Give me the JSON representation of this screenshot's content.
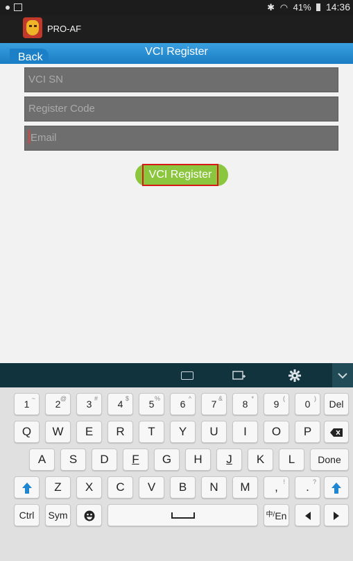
{
  "status_bar": {
    "battery": "41%",
    "time": "14:36",
    "bluetooth_icon": "bluetooth-icon",
    "wifi_icon": "wifi-icon"
  },
  "app": {
    "name": "PRO-AF",
    "logo_icon": "lion-logo-icon"
  },
  "nav": {
    "back_label": "Back",
    "title": "VCI Register"
  },
  "form": {
    "vci_sn_placeholder": "VCI SN",
    "register_code_placeholder": "Register Code",
    "email_placeholder": "Email",
    "register_button": "VCI Register"
  },
  "keyboard": {
    "toolbar_icons": [
      "keyboard-icon",
      "clipboard-icon",
      "gear-icon",
      "chevron-down-icon"
    ],
    "number_row": [
      {
        "main": "1",
        "sub": "~"
      },
      {
        "main": "2",
        "sub": "@"
      },
      {
        "main": "3",
        "sub": "#"
      },
      {
        "main": "4",
        "sub": "$"
      },
      {
        "main": "5",
        "sub": "%"
      },
      {
        "main": "6",
        "sub": "^"
      },
      {
        "main": "7",
        "sub": "&"
      },
      {
        "main": "8",
        "sub": "*"
      },
      {
        "main": "9",
        "sub": "("
      },
      {
        "main": "0",
        "sub": ")"
      }
    ],
    "del_label": "Del",
    "row_qwerty": [
      "Q",
      "W",
      "E",
      "R",
      "T",
      "Y",
      "U",
      "I",
      "O",
      "P"
    ],
    "row_asdf": [
      "A",
      "S",
      "D",
      "F",
      "G",
      "H",
      "J",
      "K",
      "L"
    ],
    "done_label": "Done",
    "row_zxcv": [
      "Z",
      "X",
      "C",
      "V",
      "B",
      "N",
      "M"
    ],
    "comma": {
      "main": ",",
      "sub": "!"
    },
    "period": {
      "main": ".",
      "sub": "?"
    },
    "ctrl_label": "Ctrl",
    "sym_label": "Sym",
    "lang_label": "En",
    "lang_sub": "中/"
  },
  "colors": {
    "accent": "#2b8fd6",
    "button_green": "#8cc63f",
    "highlight_red": "#d81818"
  }
}
